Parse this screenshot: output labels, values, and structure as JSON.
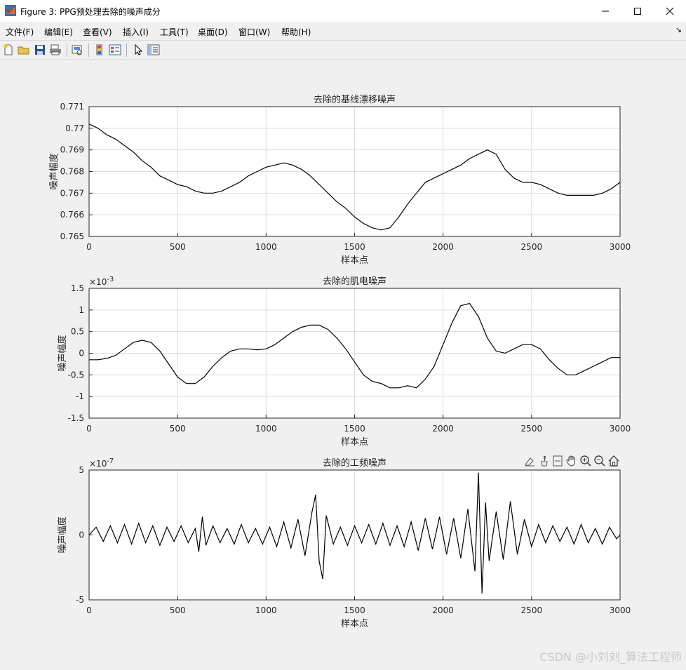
{
  "window": {
    "title": "Figure 3: PPG预处理去除的噪声成分"
  },
  "menu": [
    {
      "label": "文件(F)"
    },
    {
      "label": "编辑(E)"
    },
    {
      "label": "查看(V)"
    },
    {
      "label": "插入(I)"
    },
    {
      "label": "工具(T)"
    },
    {
      "label": "桌面(D)"
    },
    {
      "label": "窗口(W)"
    },
    {
      "label": "帮助(H)"
    }
  ],
  "toolbar": {
    "buttons": [
      "new-figure-icon",
      "open-file-icon",
      "save-icon",
      "print-icon",
      "print-preview-icon",
      "colorbar-icon",
      "legend-icon",
      "pointer-icon",
      "property-inspector-icon"
    ]
  },
  "axes_toolbar": [
    "export-icon",
    "brush-icon",
    "data-tip-icon",
    "pan-icon",
    "zoom-in-icon",
    "zoom-out-icon",
    "home-icon"
  ],
  "colors": {
    "line": "#000000",
    "grid": "#dcdcdc",
    "axes_bg": "#ffffff",
    "figure_bg": "#f0f0f0"
  },
  "chart_data": [
    {
      "type": "line",
      "title": "去除的基线漂移噪声",
      "xlabel": "样本点",
      "ylabel": "噪声幅度",
      "xlim": [
        0,
        3000
      ],
      "ylim": [
        0.765,
        0.771
      ],
      "xticks": [
        "0",
        "500",
        "1000",
        "1500",
        "2000",
        "2500",
        "3000"
      ],
      "yticks": [
        "0.771",
        "0.77",
        "0.769",
        "0.768",
        "0.767",
        "0.766",
        "0.765"
      ],
      "exponent": "",
      "grid": true,
      "x": [
        0,
        50,
        100,
        150,
        200,
        250,
        300,
        350,
        400,
        450,
        500,
        550,
        600,
        650,
        700,
        750,
        800,
        850,
        900,
        950,
        1000,
        1050,
        1100,
        1150,
        1200,
        1250,
        1300,
        1350,
        1400,
        1450,
        1500,
        1550,
        1600,
        1650,
        1700,
        1750,
        1800,
        1850,
        1900,
        1950,
        2000,
        2050,
        2100,
        2150,
        2200,
        2250,
        2300,
        2350,
        2400,
        2450,
        2500,
        2550,
        2600,
        2650,
        2700,
        2750,
        2800,
        2850,
        2900,
        2950,
        3000
      ],
      "y": [
        0.7702,
        0.77,
        0.7697,
        0.7695,
        0.7692,
        0.7689,
        0.7685,
        0.7682,
        0.7678,
        0.7676,
        0.7674,
        0.7673,
        0.7671,
        0.767,
        0.767,
        0.7671,
        0.7673,
        0.7675,
        0.7678,
        0.768,
        0.7682,
        0.7683,
        0.7684,
        0.7683,
        0.7681,
        0.7678,
        0.7674,
        0.767,
        0.7666,
        0.7663,
        0.7659,
        0.7656,
        0.7654,
        0.7653,
        0.7654,
        0.7659,
        0.7665,
        0.767,
        0.7675,
        0.7677,
        0.7679,
        0.7681,
        0.7683,
        0.7686,
        0.7688,
        0.769,
        0.7688,
        0.7681,
        0.7677,
        0.7675,
        0.7675,
        0.7674,
        0.7672,
        0.767,
        0.7669,
        0.7669,
        0.7669,
        0.7669,
        0.767,
        0.7672,
        0.7675
      ]
    },
    {
      "type": "line",
      "title": "去除的肌电噪声",
      "xlabel": "样本点",
      "ylabel": "噪声幅度",
      "xlim": [
        0,
        3000
      ],
      "ylim": [
        -0.0015,
        0.0015
      ],
      "xticks": [
        "0",
        "500",
        "1000",
        "1500",
        "2000",
        "2500",
        "3000"
      ],
      "yticks": [
        "1.5",
        "1",
        "0.5",
        "0",
        "-0.5",
        "-1",
        "-1.5"
      ],
      "exponent": "-3",
      "grid": true,
      "x": [
        0,
        50,
        100,
        150,
        200,
        250,
        300,
        350,
        400,
        450,
        500,
        550,
        600,
        650,
        700,
        750,
        800,
        850,
        900,
        950,
        1000,
        1050,
        1100,
        1150,
        1200,
        1250,
        1300,
        1350,
        1400,
        1450,
        1500,
        1550,
        1600,
        1650,
        1700,
        1750,
        1800,
        1850,
        1900,
        1950,
        2000,
        2050,
        2100,
        2150,
        2200,
        2250,
        2300,
        2350,
        2400,
        2450,
        2500,
        2550,
        2600,
        2650,
        2700,
        2750,
        2800,
        2850,
        2900,
        2950,
        3000
      ],
      "y": [
        -0.00015,
        -0.00015,
        -0.00012,
        -5e-05,
        0.0001,
        0.00025,
        0.0003,
        0.00025,
        5e-05,
        -0.00025,
        -0.00055,
        -0.0007,
        -0.0007,
        -0.00055,
        -0.0003,
        -0.0001,
        5e-05,
        0.0001,
        0.0001,
        8e-05,
        0.0001,
        0.0002,
        0.00035,
        0.0005,
        0.0006,
        0.00065,
        0.00065,
        0.00055,
        0.00035,
        0.0001,
        -0.0002,
        -0.0005,
        -0.00065,
        -0.0007,
        -0.0008,
        -0.0008,
        -0.00075,
        -0.0008,
        -0.0006,
        -0.0003,
        0.0002,
        0.0007,
        0.0011,
        0.00115,
        0.00085,
        0.00035,
        5e-05,
        0.0,
        0.0001,
        0.0002,
        0.0002,
        0.0001,
        -0.00015,
        -0.00035,
        -0.0005,
        -0.0005,
        -0.0004,
        -0.0003,
        -0.0002,
        -0.0001,
        -0.0001
      ]
    },
    {
      "type": "line",
      "title": "去除的工频噪声",
      "xlabel": "样本点",
      "ylabel": "噪声幅度",
      "xlim": [
        0,
        3000
      ],
      "ylim": [
        -5e-07,
        5e-07
      ],
      "xticks": [
        "0",
        "500",
        "1000",
        "1500",
        "2000",
        "2500",
        "3000"
      ],
      "yticks": [
        "5",
        "0",
        "-5"
      ],
      "exponent": "-7",
      "grid": true,
      "x": [
        0,
        40,
        80,
        120,
        160,
        200,
        240,
        280,
        320,
        360,
        400,
        440,
        480,
        520,
        560,
        600,
        620,
        640,
        660,
        700,
        740,
        780,
        820,
        860,
        900,
        940,
        980,
        1020,
        1060,
        1100,
        1140,
        1180,
        1220,
        1260,
        1280,
        1300,
        1320,
        1340,
        1380,
        1420,
        1460,
        1500,
        1540,
        1580,
        1620,
        1660,
        1700,
        1740,
        1780,
        1820,
        1860,
        1900,
        1940,
        1980,
        2020,
        2060,
        2100,
        2140,
        2180,
        2200,
        2220,
        2240,
        2260,
        2300,
        2340,
        2380,
        2420,
        2460,
        2500,
        2540,
        2580,
        2620,
        2660,
        2700,
        2740,
        2780,
        2820,
        2860,
        2900,
        2940,
        2980,
        3000
      ],
      "y": [
        0,
        6e-08,
        -5e-08,
        7e-08,
        -6e-08,
        8e-08,
        -7e-08,
        9e-08,
        -6e-08,
        7e-08,
        -8e-08,
        6e-08,
        -5e-08,
        7e-08,
        -6e-08,
        5e-08,
        -1.3e-07,
        1.4e-07,
        -8e-08,
        7e-08,
        -6e-08,
        5e-08,
        -7e-08,
        8e-08,
        -6e-08,
        5e-08,
        -7e-08,
        6e-08,
        -9e-08,
        1e-07,
        -1e-07,
        1.2e-07,
        -1.6e-07,
        1.8e-07,
        3.1e-07,
        -2e-07,
        -3.4e-07,
        1.5e-07,
        -7e-08,
        6e-08,
        -8e-08,
        7e-08,
        -6e-08,
        8e-08,
        -7e-08,
        9e-08,
        -8e-08,
        7e-08,
        -9e-08,
        1e-07,
        -1.2e-07,
        1.3e-07,
        -1.1e-07,
        1.4e-07,
        -1.5e-07,
        1.3e-07,
        -1.8e-07,
        2e-07,
        -2.8e-07,
        4.8e-07,
        -4.5e-07,
        2.5e-07,
        -2e-07,
        1.8e-07,
        -1.9e-07,
        2.6e-07,
        -1.5e-07,
        1.2e-07,
        -9e-08,
        8e-08,
        -6e-08,
        7e-08,
        -5e-08,
        6e-08,
        -7e-08,
        8e-08,
        -6e-08,
        5e-08,
        -7e-08,
        6e-08,
        -3e-08,
        0
      ]
    }
  ],
  "watermark": "CSDN @小刘刘_算法工程师"
}
